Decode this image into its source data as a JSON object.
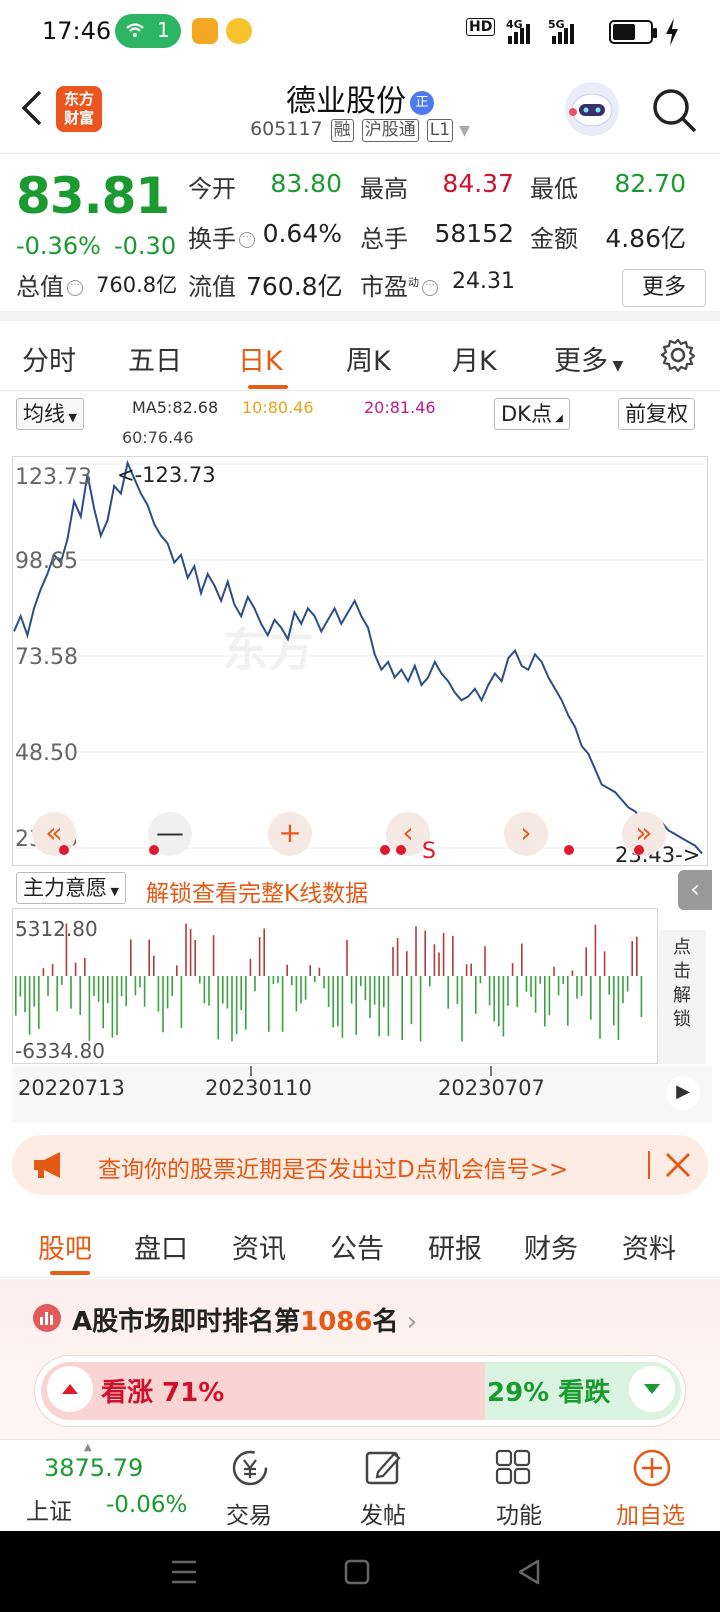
{
  "status": {
    "time": "17:46",
    "wifi_count": "1",
    "signal_labels": [
      "HD",
      "4G",
      "5G"
    ]
  },
  "header": {
    "logo_text": [
      "东方",
      "财富"
    ],
    "stock_name": "德业股份",
    "name_badge": "正",
    "code": "605117",
    "tags": [
      "融",
      "沪股通",
      "L1"
    ]
  },
  "quote": {
    "price": "83.81",
    "change_pct": "-0.36%",
    "change": "-0.30",
    "open_label": "今开",
    "open": "83.80",
    "high_label": "最高",
    "high": "84.37",
    "low_label": "最低",
    "low": "82.70",
    "turnover_label": "换手",
    "turnover": "0.64%",
    "volume_label": "总手",
    "volume": "58152",
    "amount_label": "金额",
    "amount": "4.86亿",
    "mktcap_label": "总值",
    "mktcap": "760.8亿",
    "float_label": "流值",
    "float": "760.8亿",
    "pe_label": "市盈",
    "pe_sup": "动",
    "pe": "24.31",
    "more": "更多"
  },
  "ktabs": {
    "items": [
      "分时",
      "五日",
      "日K",
      "周K",
      "月K",
      "更多"
    ],
    "active": "日K"
  },
  "chart_toolbar": {
    "ma_select": "均线",
    "dk": "DK点",
    "adjust": "前复权",
    "ma5": "MA5:82.68",
    "ma10": "10:80.46",
    "ma20": "20:81.46",
    "ma60": "60:76.46",
    "ma5_color": "#333333",
    "ma10_color": "#e6a316",
    "ma20_color": "#c0188c"
  },
  "chart_data": {
    "type": "line",
    "y_ticks": [
      "123.73",
      "98.65",
      "73.58",
      "48.50",
      "23.43"
    ],
    "ylim": [
      23.43,
      123.73
    ],
    "max_label": "<-123.73",
    "min_label": "23.43->",
    "x_ticks": [
      "20220713",
      "20230110",
      "20230707"
    ],
    "series": [
      {
        "values": [
          80,
          84,
          79,
          86,
          91,
          95,
          100,
          98,
          104,
          114,
          110,
          121,
          112,
          105,
          109,
          118,
          116,
          124,
          120,
          116,
          113,
          108,
          105,
          103,
          98,
          100,
          94,
          97,
          90,
          95,
          92,
          88,
          93,
          87,
          84,
          89,
          86,
          82,
          79,
          83,
          81,
          78,
          85,
          82,
          86,
          84,
          80,
          83,
          86,
          82,
          85,
          88,
          84,
          81,
          74,
          70,
          72,
          68,
          70,
          67,
          71,
          66,
          68,
          72,
          69,
          67,
          64,
          62,
          63,
          65,
          62,
          66,
          69,
          67,
          73,
          75,
          71,
          70,
          74,
          72,
          68,
          65,
          62,
          58,
          55,
          50,
          48,
          44,
          40,
          39,
          38,
          36,
          34,
          33,
          31,
          30,
          29,
          30,
          28,
          27,
          26,
          25,
          24,
          22
        ]
      }
    ],
    "volume_ticks": [
      "5312.80",
      "-6334.80"
    ]
  },
  "chart_controls": {
    "signal_letter": "S"
  },
  "flow": {
    "select": "主力意愿",
    "unlock_text": "解锁查看完整K线数据",
    "side_unlock": [
      "点",
      "击",
      "解",
      "锁"
    ]
  },
  "banner": {
    "text": "查询你的股票近期是否发出过D点机会信号>>"
  },
  "news_tabs": {
    "items": [
      "股吧",
      "盘口",
      "资讯",
      "公告",
      "研报",
      "财务",
      "资料"
    ],
    "active": "股吧"
  },
  "rank": {
    "prefix": "A股市场即时排名第",
    "rank": "1086",
    "suffix": "名"
  },
  "vote": {
    "up_label": "看涨 71%",
    "down_label": "29% 看跌",
    "up_pct": 71
  },
  "bottom_nav": {
    "index_value": "3875.79",
    "index_name": "上证",
    "index_change": "-0.06%",
    "items": [
      "交易",
      "发帖",
      "功能",
      "加自选"
    ]
  }
}
